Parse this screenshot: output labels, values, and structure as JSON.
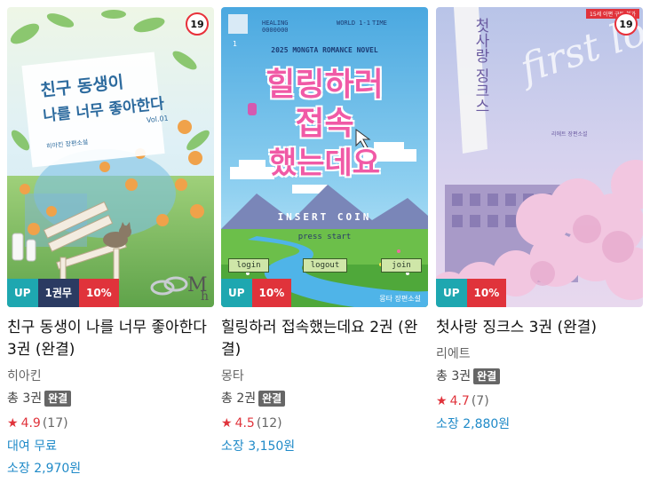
{
  "books": [
    {
      "age_rating": "19",
      "cover_title_line1": "친구 동생이",
      "cover_title_line2": "나를 너무 좋아한다",
      "cover_vol": "Vol.01",
      "cover_author": "히아킨 장편소설",
      "tags": {
        "up": "UP",
        "vol": "1권무",
        "discount": "10%"
      },
      "title": "친구 동생이 나를 너무 좋아한다 3권 (완결)",
      "author": "히아킨",
      "volumes": "총 3권",
      "status": "완결",
      "rating": "4.9",
      "rating_count": "(17)",
      "rental_price": "대여 무료",
      "own_price": "소장 2,970원"
    },
    {
      "age_rating": "",
      "cover_hud_left": "HEALING 0000000",
      "cover_hud_mid": "WORLD 1-1",
      "cover_hud_right": "TIME",
      "cover_subtitle": "2025 MONGTA ROMANCE NOVEL",
      "cover_title_line1": "힐링하러",
      "cover_title_line2": "접속",
      "cover_title_line3": "했는데요",
      "cover_insert": "INSERT COIN",
      "cover_press": "press start",
      "cover_btn_login": "login",
      "cover_btn_logout": "logout",
      "cover_btn_join": "join",
      "cover_author": "몽타 장편소설",
      "tags": {
        "up": "UP",
        "discount": "10%"
      },
      "title": "힐링하러 접속했는데요 2권 (완결)",
      "author": "몽타",
      "volumes": "총 2권",
      "status": "완결",
      "rating": "4.5",
      "rating_count": "(12)",
      "own_price": "소장 3,150원"
    },
    {
      "age_rating": "19",
      "cover_notice": "15세 이편 구독 불가",
      "cover_title": "첫사랑 징크스",
      "cover_script": "first love",
      "cover_author": "리에트 장편소설",
      "tags": {
        "up": "UP",
        "discount": "10%"
      },
      "title": "첫사랑 징크스 3권 (완결)",
      "author": "리에트",
      "volumes": "총 3권",
      "status": "완결",
      "rating": "4.7",
      "rating_count": "(7)",
      "own_price": "소장 2,880원"
    }
  ],
  "colors": {
    "accent_up": "#1ea7b0",
    "discount": "#e0333b",
    "price_link": "#1f8ac8",
    "star": "#e0333b"
  },
  "icons": {
    "star": "star-icon",
    "age": "age-19-badge"
  }
}
